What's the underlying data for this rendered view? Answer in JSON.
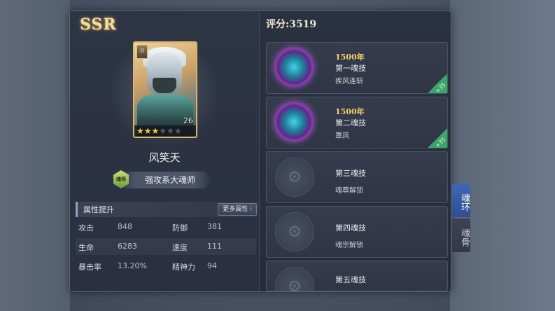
{
  "rarity": "SSR",
  "hero": {
    "name": "风笑天",
    "level": "26",
    "stars_filled": 3,
    "stars_total": 6,
    "card_badge": "II",
    "title": "强攻系大魂师",
    "title_icon_text": "魂师"
  },
  "attributes": {
    "header": "属性提升",
    "more_label": "更多属性",
    "rows": [
      {
        "k1": "攻击",
        "v1": "848",
        "k2": "防御",
        "v2": "381"
      },
      {
        "k1": "生命",
        "v1": "6283",
        "k2": "速度",
        "v2": "111"
      },
      {
        "k1": "暴击率",
        "v1": "13.20%",
        "k2": "精神力",
        "v2": "94"
      }
    ]
  },
  "score": "评分:3519",
  "rings": [
    {
      "age": "1500年",
      "name": "第一魂技",
      "skill": "疾风连斩",
      "tag": "+35"
    },
    {
      "age": "1500年",
      "name": "第二魂技",
      "skill": "罩风",
      "tag": "+35"
    },
    {
      "name": "第三魂技",
      "hint": "魂尊解锁"
    },
    {
      "name": "第四魂技",
      "hint": "魂宗解锁"
    },
    {
      "name": "第五魂技",
      "hint": ""
    }
  ],
  "side_tabs": {
    "active": "魂环",
    "inactive": "魂骨"
  },
  "colors": {
    "gold": "#f2cf6a",
    "tab_active": "#3f68b6",
    "corner_green": "#3aa76a"
  }
}
